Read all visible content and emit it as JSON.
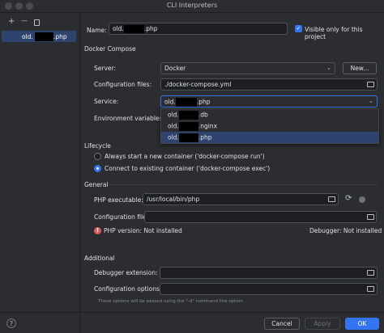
{
  "window": {
    "title": "CLI Interpreters"
  },
  "sidebar": {
    "add_icon": "+",
    "remove_icon": "—",
    "copy_icon": "copy",
    "items": [
      {
        "prefix": "old.",
        "suffix": ".php"
      }
    ]
  },
  "name_row": {
    "label": "Name:",
    "value_prefix": "old.",
    "value_suffix": ".php",
    "visible_label": "Visible only for this project",
    "visible_checked": true
  },
  "docker_compose": {
    "section": "Docker Compose",
    "server_label": "Server:",
    "server_value": "Docker",
    "new_button": "New...",
    "config_label": "Configuration files:",
    "config_value": "./docker-compose.yml",
    "service_label": "Service:",
    "service_value_prefix": "old.",
    "service_value_suffix": ".php",
    "env_label": "Environment variables:",
    "options": [
      {
        "prefix": "old.",
        "suffix": ".db"
      },
      {
        "prefix": "old.",
        "suffix": ".nginx"
      },
      {
        "prefix": "old.",
        "suffix": ".php"
      }
    ]
  },
  "lifecycle": {
    "section": "Lifecycle",
    "option1": "Always start a new container ('docker-compose run')",
    "option2": "Connect to existing container ('docker-compose exec')",
    "selected": 2
  },
  "general": {
    "section": "General",
    "php_exec_label": "PHP executable:",
    "php_exec_value": "/usr/local/bin/php",
    "config_file_label": "Configuration file:",
    "config_file_value": "",
    "php_version": "PHP version: Not installed",
    "debugger": "Debugger: Not installed"
  },
  "additional": {
    "section": "Additional",
    "debugger_ext_label": "Debugger extension:",
    "config_options_label": "Configuration options:",
    "hint": "These options will be passed using the \"-d\" command line option"
  },
  "footer": {
    "help": "?",
    "cancel": "Cancel",
    "apply": "Apply",
    "ok": "OK"
  },
  "colors": {
    "accent": "#3574f0",
    "background": "#2b2d30",
    "error": "#db5c5c"
  }
}
